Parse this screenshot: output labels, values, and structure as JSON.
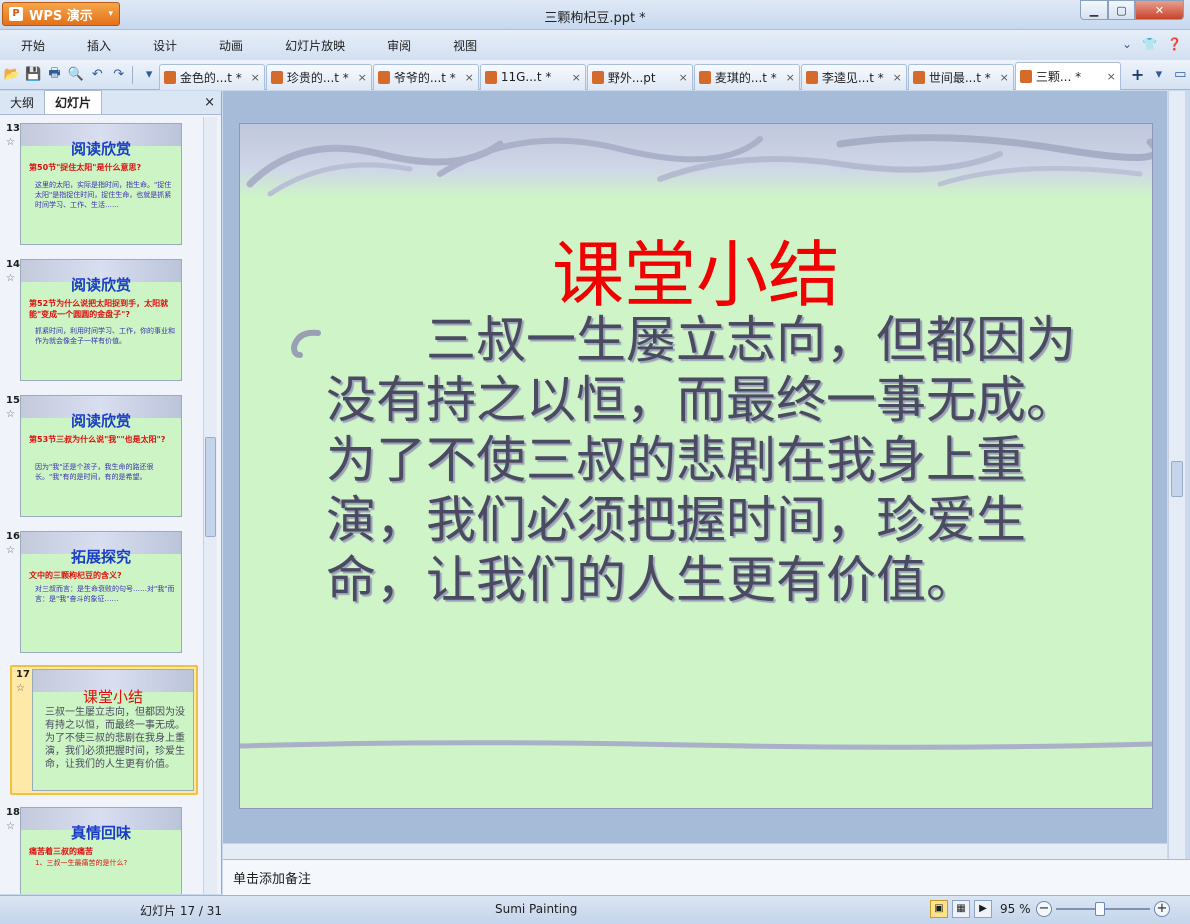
{
  "app": {
    "wps_label": "WPS 演示",
    "doc_title": "三颗枸杞豆.ppt *"
  },
  "menu": [
    "开始",
    "插入",
    "设计",
    "动画",
    "幻灯片放映",
    "审阅",
    "视图"
  ],
  "tabs": [
    {
      "label": "金色的...t *",
      "close": "×"
    },
    {
      "label": "珍贵的...t *",
      "close": "×"
    },
    {
      "label": "爷爷的...t *",
      "close": "×"
    },
    {
      "label": "11G...t *",
      "close": "×"
    },
    {
      "label": "野外...pt",
      "close": "×"
    },
    {
      "label": "麦琪的...t *",
      "close": "×"
    },
    {
      "label": "李逵见...t *",
      "close": "×"
    },
    {
      "label": "世间最...t *",
      "close": "×"
    },
    {
      "label": "三颗... *",
      "close": "×"
    }
  ],
  "pane": {
    "tab_outline": "大纲",
    "tab_slides": "幻灯片",
    "close": "×"
  },
  "thumbs": [
    {
      "num": "13",
      "title": "阅读欣赏",
      "q": "第50节\"捉住太阳\"是什么意思?",
      "a": "这里的太阳，实际是指时间，指生命。\"捉住太阳\"是指捉住时间，捉住生命，也就是抓紧时间学习、工作、生活……"
    },
    {
      "num": "14",
      "title": "阅读欣赏",
      "q": "第52节为什么说把太阳捉到手，太阳就能\"变成一个圆圆的金盘子\"?",
      "a": "抓紧时间，利用时间学习、工作，你的事业和作为就会像金子一样有价值。"
    },
    {
      "num": "15",
      "title": "阅读欣赏",
      "q": "第53节三叔为什么说\"我\"\"也是太阳\"?",
      "a": "因为\"我\"还是个孩子，我生命的路还很长。\"我\"有的是时间，有的是希望。"
    },
    {
      "num": "16",
      "title": "拓展探究",
      "q": "文中的三颗枸杞豆的含义?",
      "a": "对三叔而言：是生命衰败的句号……对\"我\"而言：是\"我\"奋斗的象征……"
    }
  ],
  "selected_thumb": {
    "num": "17",
    "title": "课堂小结",
    "body": "三叔一生屡立志向，但都因为没有持之以恒，而最终一事无成。为了不使三叔的悲剧在我身上重演，我们必须把握时间，珍爱生命，让我们的人生更有价值。"
  },
  "thumb_18": {
    "num": "18",
    "title": "真情回味",
    "q": "痛苦着三叔的痛苦",
    "a": "1、三叔一生最痛苦的是什么?"
  },
  "slide": {
    "title": "课堂小结",
    "body": "三叔一生屡立志向，但都因为没有持之以恒，而最终一事无成。为了不使三叔的悲剧在我身上重演，我们必须把握时间，珍爱生命，让我们的人生更有价值。"
  },
  "notes_placeholder": "单击添加备注",
  "status": {
    "slide_info": "幻灯片 17 / 31",
    "theme": "Sumi Painting",
    "zoom": "95 %"
  },
  "colors": {
    "slide_bg": "#cff4c7",
    "title_red": "#f00000",
    "body_text": "#4a4a60"
  }
}
